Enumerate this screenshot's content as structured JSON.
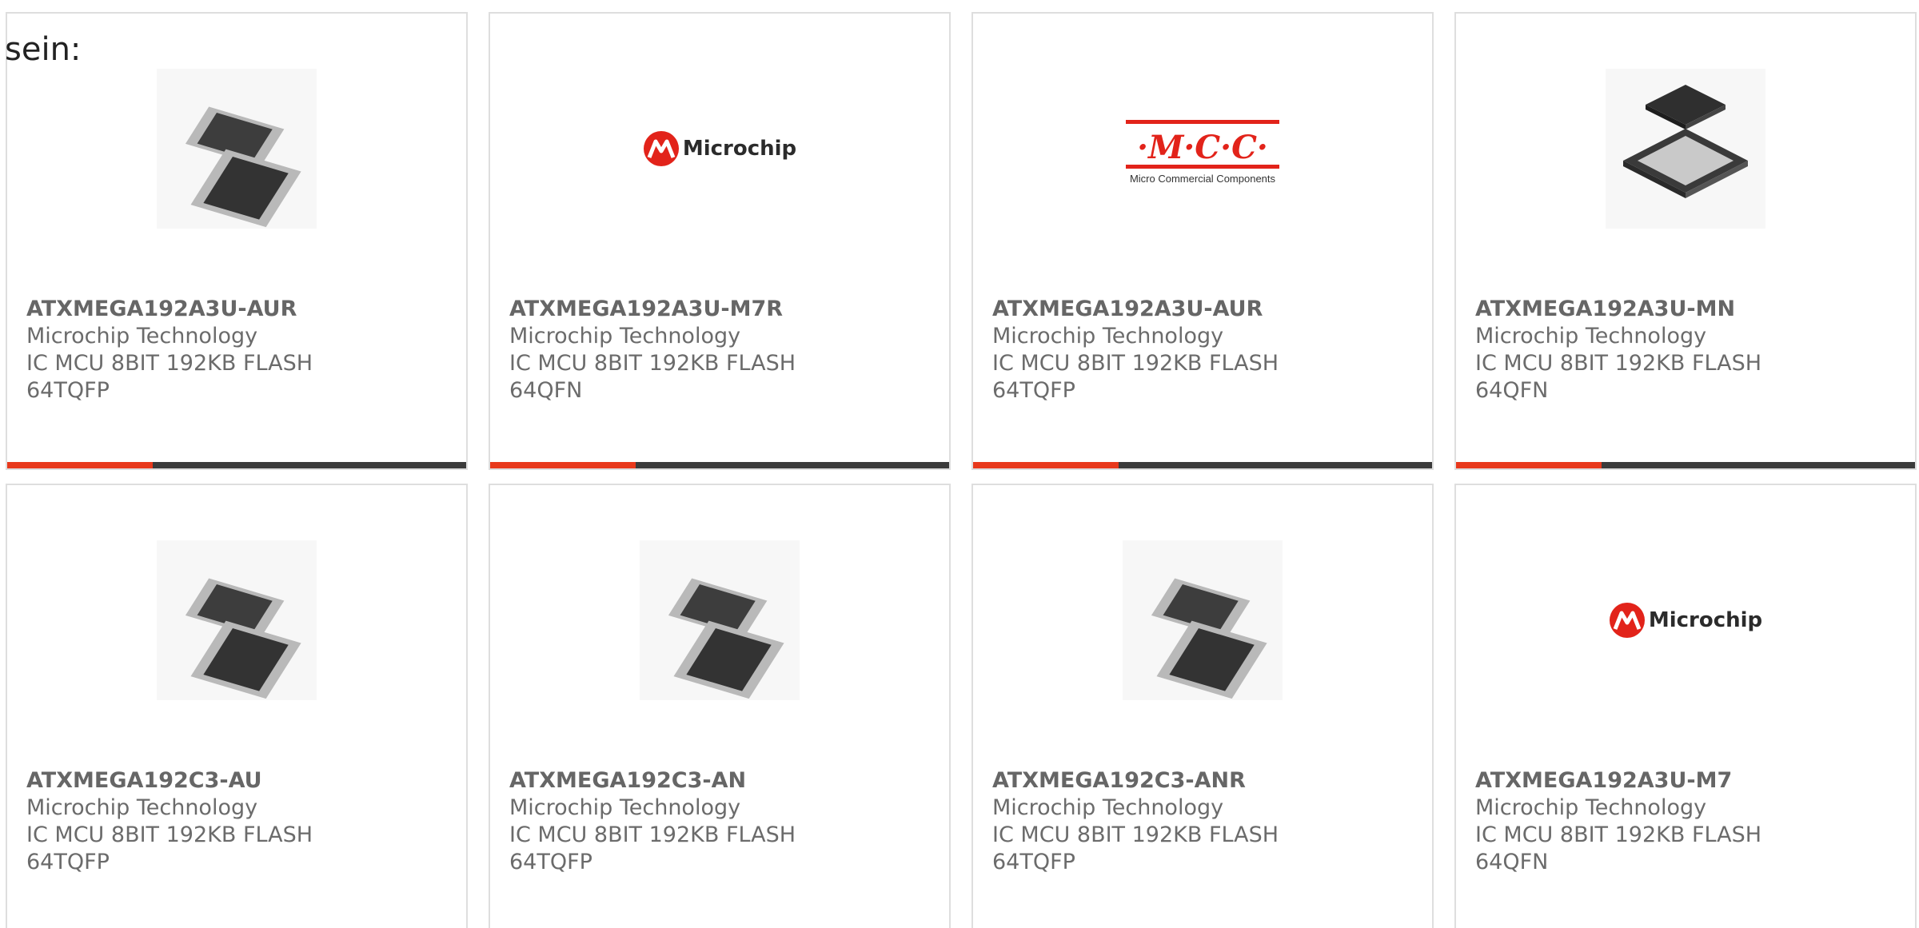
{
  "lead_text": "sein:",
  "colors": {
    "accent": "#e8391c",
    "bar": "#3b3b3b",
    "border": "#dedede",
    "text": "#6b6b6b",
    "microchip_red": "#e2231a"
  },
  "products": [
    {
      "part_number": "ATXMEGA192A3U-AUR",
      "manufacturer": "Microchip Technology",
      "desc_line1": "IC MCU 8BIT 192KB FLASH",
      "desc_line2": "64TQFP",
      "image": "tqfp-chip-icon"
    },
    {
      "part_number": "ATXMEGA192A3U-M7R",
      "manufacturer": "Microchip Technology",
      "desc_line1": "IC MCU 8BIT 192KB FLASH",
      "desc_line2": "64QFN",
      "image": "microchip-logo",
      "logo_text": "Microchip"
    },
    {
      "part_number": "ATXMEGA192A3U-AUR",
      "manufacturer": "Microchip Technology",
      "desc_line1": "IC MCU 8BIT 192KB FLASH",
      "desc_line2": "64TQFP",
      "image": "mcc-logo",
      "logo_text": "·M·C·C·",
      "logo_subtext": "Micro Commercial Components"
    },
    {
      "part_number": "ATXMEGA192A3U-MN",
      "manufacturer": "Microchip Technology",
      "desc_line1": "IC MCU 8BIT 192KB FLASH",
      "desc_line2": "64QFN",
      "image": "qfn-chip-icon"
    },
    {
      "part_number": "ATXMEGA192C3-AU",
      "manufacturer": "Microchip Technology",
      "desc_line1": "IC MCU 8BIT 192KB FLASH",
      "desc_line2": "64TQFP",
      "image": "tqfp-chip-icon"
    },
    {
      "part_number": "ATXMEGA192C3-AN",
      "manufacturer": "Microchip Technology",
      "desc_line1": "IC MCU 8BIT 192KB FLASH",
      "desc_line2": "64TQFP",
      "image": "tqfp-chip-icon"
    },
    {
      "part_number": "ATXMEGA192C3-ANR",
      "manufacturer": "Microchip Technology",
      "desc_line1": "IC MCU 8BIT 192KB FLASH",
      "desc_line2": "64TQFP",
      "image": "tqfp-chip-icon"
    },
    {
      "part_number": "ATXMEGA192A3U-M7",
      "manufacturer": "Microchip Technology",
      "desc_line1": "IC MCU 8BIT 192KB FLASH",
      "desc_line2": "64QFN",
      "image": "microchip-logo",
      "logo_text": "Microchip"
    }
  ]
}
